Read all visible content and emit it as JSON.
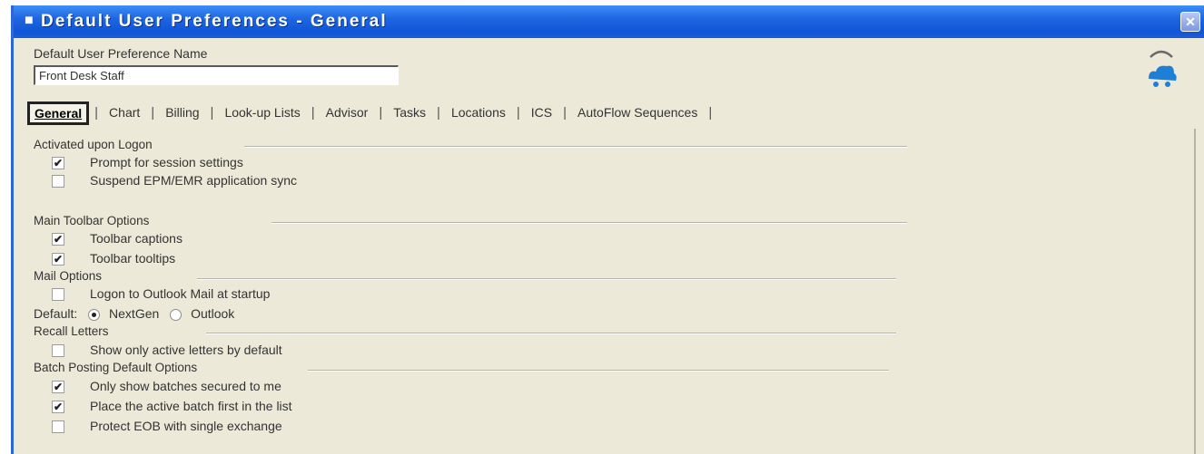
{
  "window": {
    "title": "Default User Preferences - General",
    "title_icon": "app-icon",
    "close_glyph": "✕",
    "title_bar_color": "#0f55d6",
    "body_color": "#ece9d8"
  },
  "header": {
    "pref_name_label": "Default User Preference Name",
    "pref_name_value": "Front Desk Staff",
    "logo_icon": "pile-logo-icon"
  },
  "tabs": [
    {
      "label": "General",
      "active": true
    },
    {
      "label": "Chart"
    },
    {
      "label": "Billing"
    },
    {
      "label": "Look-up Lists"
    },
    {
      "label": "Advisor"
    },
    {
      "label": "Tasks"
    },
    {
      "label": "Locations"
    },
    {
      "label": "ICS"
    },
    {
      "label": "AutoFlow Sequences"
    }
  ],
  "groups": {
    "logon": {
      "header": "Activated upon Logon",
      "items": [
        {
          "label": "Prompt for session settings",
          "checked": true
        },
        {
          "label": "Suspend EPM/EMR application sync",
          "checked": false
        }
      ]
    },
    "toolbar": {
      "header": "Main Toolbar Options",
      "items": [
        {
          "label": "Toolbar captions",
          "checked": true
        },
        {
          "label": "Toolbar tooltips",
          "checked": true
        }
      ]
    },
    "mail": {
      "header": "Mail Options",
      "items": [
        {
          "label": "Logon to Outlook Mail at startup",
          "checked": false
        }
      ],
      "default_label": "Default:",
      "radio_options": [
        {
          "label": "NextGen",
          "selected": true
        },
        {
          "label": "Outlook",
          "selected": false
        }
      ]
    },
    "recall": {
      "header": "Recall Letters",
      "items": [
        {
          "label": "Show only active letters by default",
          "checked": false
        }
      ]
    },
    "batch": {
      "header": "Batch Posting Default Options",
      "items": [
        {
          "label": "Only show batches secured to me",
          "checked": true
        },
        {
          "label": "Place the active batch first in the list",
          "checked": true
        },
        {
          "label": "Protect EOB with single exchange",
          "checked": false
        }
      ]
    }
  }
}
